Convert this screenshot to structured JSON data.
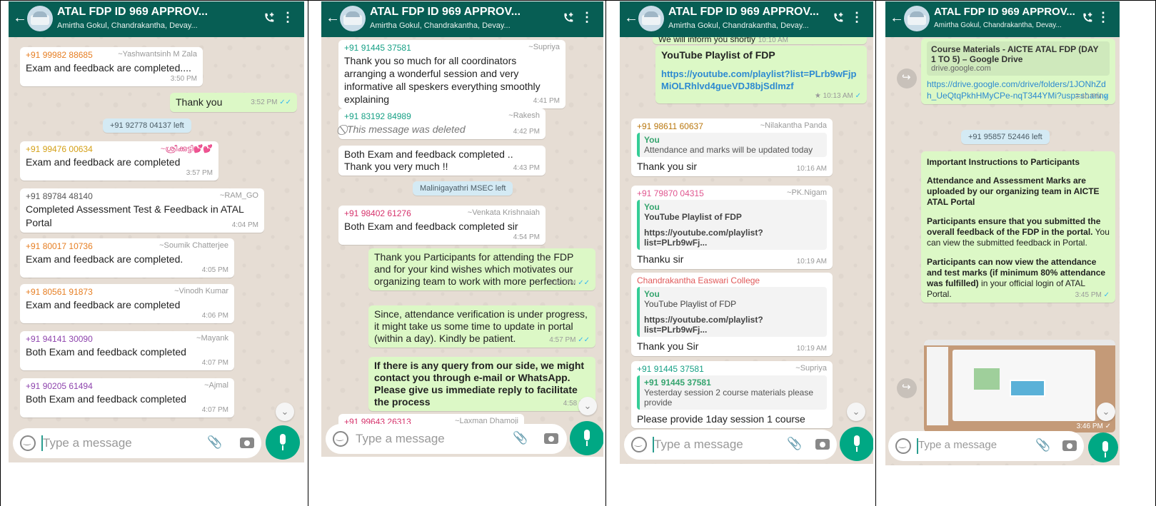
{
  "header": {
    "title": "ATAL FDP ID 969 APPROV...",
    "subtitle": "Amirtha Gokul, Chandrakantha, Devay...",
    "subtitle_short": "Amirtha Gokul, Chandrakantha, Devay..."
  },
  "composer": {
    "placeholder": "Type a message"
  },
  "panel1": {
    "m1": {
      "sender": "+91 99982 88685",
      "alias": "~Yashwantsinh M Zala",
      "text": "Exam and feedback are completed....",
      "time": "3:50 PM"
    },
    "m2": {
      "text": "Thank you",
      "time": "3:52 PM"
    },
    "sys1": "+91 92778 04137 left",
    "m3": {
      "sender": "+91 99476 00634",
      "alias": "~ശ്രീക്കുട്ടി💕💕",
      "text": "Exam and feedback are completed",
      "time": "3:57 PM"
    },
    "m4": {
      "sender": "+91 89784 48140",
      "alias": "~RAM_GO",
      "text": "Completed Assessment Test & Feedback in ATAL Portal",
      "time": "4:04 PM"
    },
    "m5": {
      "sender": "+91 80017 10736",
      "alias": "~Soumik Chatterjee",
      "text": "Exam and feedback are completed.",
      "time": "4:05 PM"
    },
    "m6": {
      "sender": "+91 80561 91873",
      "alias": "~Vinodh Kumar",
      "text": "Exam and feedback are completed",
      "time": "4:06 PM"
    },
    "m7": {
      "sender": "+91 94141 30090",
      "alias": "~Mayank",
      "text": "Both Exam and feedback completed",
      "time": "4:07 PM"
    },
    "m8": {
      "sender": "+91 90205 61494",
      "alias": "~Ajmal",
      "text": "Both Exam and feedback completed",
      "time": "4:07 PM"
    }
  },
  "panel2": {
    "m1": {
      "sender": "+91 91445 37581",
      "alias": "~Supriya",
      "text": "Thank you so much for all coordinators arranging a wonderful session and very informative   all speskers everything smoothly explaining",
      "time": "4:41 PM"
    },
    "m2": {
      "sender": "+91 83192 84989",
      "alias": "~Rakesh",
      "text": "This message was deleted",
      "time": "4:42 PM"
    },
    "m3": {
      "text": "Both Exam and feedback completed .. Thank you very much !!",
      "time": "4:43 PM"
    },
    "sys1": "Malinigayathri MSEC left",
    "m4": {
      "sender": "+91 98402 61276",
      "alias": "~Venkata Krishnaiah",
      "text": "Both Exam and feedback completed sir",
      "time": "4:54 PM"
    },
    "m5": {
      "text": "Thank you Participants for attending the FDP and for your kind wishes which motivates our organizing team to work with more perfection.",
      "time": "4:56 PM"
    },
    "m6": {
      "text": "Since, attendance verification is under progress, it might take us some time to update in portal (within a day). Kindly be patient.",
      "time": "4:57 PM"
    },
    "m7": {
      "text": "If there is any query from our side, we might contact you through e-mail or WhatsApp. Please give us immediate reply to facilitate the process",
      "time": "4:58 PM"
    },
    "m8": {
      "sender": "+91 99643 26313",
      "alias": "~Laxman Dhamoji"
    }
  },
  "panel3": {
    "m0": {
      "text": "We will inform you shortly",
      "time": "10:10 AM"
    },
    "m1": {
      "title": "YouTube Playlist of FDP",
      "link": "https://youtube.com/playlist?list=PLrb9wFjpMiOLRhlvd4gueVDJ8bjSdlmzf",
      "time": "10:13 AM"
    },
    "m2": {
      "sender": "+91 98611 60637",
      "alias": "~Nilakantha Panda",
      "quote_name": "You",
      "quote_text": "Attendance and marks will be updated today",
      "text": "Thank you sir",
      "time": "10:16 AM"
    },
    "m3": {
      "sender": "+91 79870 04315",
      "alias": "~PK.Nigam",
      "quote_name": "You",
      "quote_title": "YouTube Playlist of FDP",
      "quote_text": "https://youtube.com/playlist?list=PLrb9wFj...",
      "text": "Thanku sir",
      "time": "10:19 AM"
    },
    "m4": {
      "sender": "Chandrakantha Easwari College",
      "quote_name": "You",
      "quote_title": "YouTube Playlist of FDP",
      "quote_text": "https://youtube.com/playlist?list=PLrb9wFj...",
      "text": "Thank you Sir",
      "time": "10:19 AM"
    },
    "m5": {
      "sender": "+91 91445 37581",
      "alias": "~Supriya",
      "quote_name": "+91 91445 37581",
      "quote_text": "Yesterday session 2 course materials please provide",
      "text": "Please provide 1day session 1 course"
    }
  },
  "panel4": {
    "m1": {
      "preview_title": "Course Materials - AICTE ATAL FDP (DAY 1 TO 5) – Google Drive",
      "preview_domain": "drive.google.com",
      "link": "https://drive.google.com/drive/folders/1JONhZdh_UeQtqPkhHMyCPe-nqT344YMi?usp=sharing",
      "time": "3:40 PM"
    },
    "sys1": "+91 95857 52446 left",
    "m2": {
      "heading": "Important Instructions to Participants",
      "p1": "Attendance and Assessment Marks are uploaded by our organizing team in AICTE ATAL Portal",
      "p2_bold": "Participants ensure that you submitted the overall feedback of the FDP in the portal.",
      "p2_rest": " You can view the submitted feedback in Portal.",
      "p3_bold": "Participants can now view the attendance and test marks (if minimum 80% attendance was fulfilled)",
      "p3_rest": " in your official login of ATAL Portal.",
      "time": "3:45 PM"
    },
    "m3": {
      "time": "3:46 PM"
    }
  }
}
